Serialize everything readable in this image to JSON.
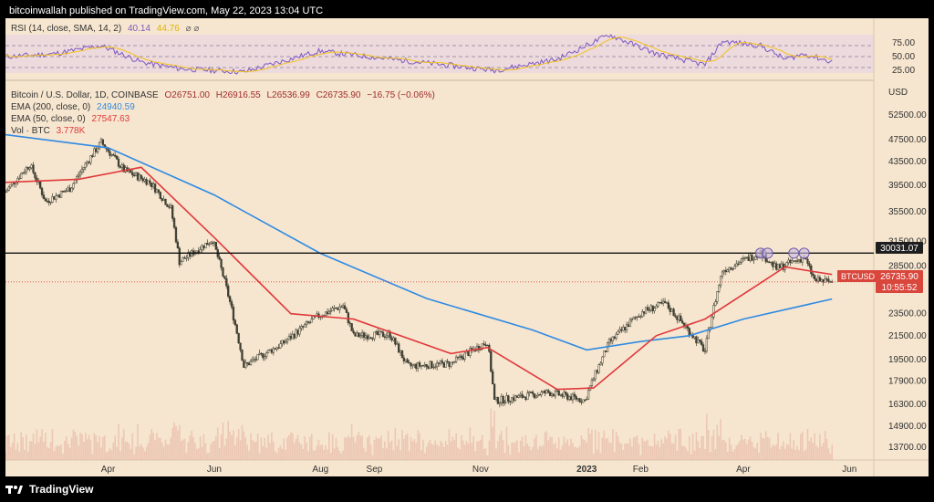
{
  "header": {
    "publish_text": "bitcoinwallah published on TradingView.com, May 22, 2023 13:04 UTC"
  },
  "footer": {
    "brand": "TradingView"
  },
  "rsi_panel": {
    "label": "RSI (14, close, SMA, 14, 2)",
    "rsi_value": "40.14",
    "sma_value": "44.76",
    "ticks": [
      "75.00",
      "50.00",
      "25.00"
    ]
  },
  "main_legend": {
    "symbol": "Bitcoin / U.S. Dollar, 1D, COINBASE",
    "open": "O26751.00",
    "high": "H26916.55",
    "low": "L26536.99",
    "close": "C26735.90",
    "change": "−16.75 (−0.06%)",
    "ema200_label": "EMA (200, close, 0)",
    "ema200_value": "24940.59",
    "ema50_label": "EMA (50, close, 0)",
    "ema50_value": "27547.63",
    "vol_label": "Vol · BTC",
    "vol_value": "3.778K"
  },
  "price_axis": {
    "unit": "USD",
    "ticks": [
      "52500.00",
      "47500.00",
      "43500.00",
      "39500.00",
      "35500.00",
      "31500.00",
      "28500.00",
      "23500.00",
      "21500.00",
      "19500.00",
      "17900.00",
      "16300.00",
      "14900.00",
      "13700.00"
    ],
    "level_label": "30031.07",
    "last_symbol": "BTCUSD",
    "last_price": "26735.90",
    "countdown": "10:55:52"
  },
  "time_axis": {
    "ticks": [
      "Apr",
      "Jun",
      "Aug",
      "Sep",
      "Nov",
      "2023",
      "Feb",
      "Apr",
      "Jun"
    ]
  },
  "colors": {
    "background": "#f6e6cf",
    "ema200": "#2f8ae3",
    "ema50": "#e0393c",
    "rsi": "#7e57c2",
    "rsi_sma": "#f2c21b",
    "candle": "#3f3f33",
    "volume": "#e8b9a8"
  },
  "chart_data": {
    "type": "candlestick",
    "symbol": "Bitcoin / U.S. Dollar",
    "interval": "1D",
    "y_scale": "log",
    "ylim": [
      13000,
      60000
    ],
    "x_range": [
      "2022-02-01",
      "2023-06-15"
    ],
    "horizontal_level": 30031.07,
    "close_path": [
      {
        "x": "2022-02-01",
        "y": 38500
      },
      {
        "x": "2022-02-15",
        "y": 43000
      },
      {
        "x": "2022-02-24",
        "y": 37000
      },
      {
        "x": "2022-03-10",
        "y": 39000
      },
      {
        "x": "2022-03-28",
        "y": 47000
      },
      {
        "x": "2022-04-10",
        "y": 42000
      },
      {
        "x": "2022-04-25",
        "y": 40000
      },
      {
        "x": "2022-05-07",
        "y": 36000
      },
      {
        "x": "2022-05-12",
        "y": 29000
      },
      {
        "x": "2022-05-31",
        "y": 31700
      },
      {
        "x": "2022-06-13",
        "y": 22500
      },
      {
        "x": "2022-06-18",
        "y": 19000
      },
      {
        "x": "2022-07-10",
        "y": 20800
      },
      {
        "x": "2022-07-31",
        "y": 23300
      },
      {
        "x": "2022-08-14",
        "y": 24300
      },
      {
        "x": "2022-08-20",
        "y": 21500
      },
      {
        "x": "2022-09-10",
        "y": 21600
      },
      {
        "x": "2022-09-20",
        "y": 19000
      },
      {
        "x": "2022-10-15",
        "y": 19200
      },
      {
        "x": "2022-11-05",
        "y": 21000
      },
      {
        "x": "2022-11-09",
        "y": 16500
      },
      {
        "x": "2022-12-10",
        "y": 17100
      },
      {
        "x": "2022-12-31",
        "y": 16550
      },
      {
        "x": "2023-01-14",
        "y": 20900
      },
      {
        "x": "2023-02-02",
        "y": 23700
      },
      {
        "x": "2023-02-15",
        "y": 24500
      },
      {
        "x": "2023-03-10",
        "y": 20200
      },
      {
        "x": "2023-03-20",
        "y": 28000
      },
      {
        "x": "2023-04-11",
        "y": 30100
      },
      {
        "x": "2023-04-20",
        "y": 28200
      },
      {
        "x": "2023-05-06",
        "y": 29500
      },
      {
        "x": "2023-05-12",
        "y": 26900
      },
      {
        "x": "2023-05-22",
        "y": 26735.9
      }
    ],
    "ema200": [
      {
        "x": "2022-02-01",
        "y": 48500
      },
      {
        "x": "2022-04-01",
        "y": 46000
      },
      {
        "x": "2022-06-01",
        "y": 38000
      },
      {
        "x": "2022-08-01",
        "y": 30000
      },
      {
        "x": "2022-10-01",
        "y": 25000
      },
      {
        "x": "2022-12-01",
        "y": 22000
      },
      {
        "x": "2023-01-01",
        "y": 20300
      },
      {
        "x": "2023-02-01",
        "y": 21000
      },
      {
        "x": "2023-03-01",
        "y": 21500
      },
      {
        "x": "2023-04-01",
        "y": 23000
      },
      {
        "x": "2023-05-22",
        "y": 24940.59
      }
    ],
    "ema50": [
      {
        "x": "2022-02-01",
        "y": 40000
      },
      {
        "x": "2022-03-15",
        "y": 40500
      },
      {
        "x": "2022-04-20",
        "y": 42500
      },
      {
        "x": "2022-06-01",
        "y": 32000
      },
      {
        "x": "2022-07-15",
        "y": 23500
      },
      {
        "x": "2022-08-20",
        "y": 23000
      },
      {
        "x": "2022-10-15",
        "y": 20000
      },
      {
        "x": "2022-11-05",
        "y": 20500
      },
      {
        "x": "2022-12-15",
        "y": 17300
      },
      {
        "x": "2023-01-05",
        "y": 17400
      },
      {
        "x": "2023-02-10",
        "y": 21500
      },
      {
        "x": "2023-03-10",
        "y": 23000
      },
      {
        "x": "2023-04-10",
        "y": 26500
      },
      {
        "x": "2023-04-25",
        "y": 28400
      },
      {
        "x": "2023-05-22",
        "y": 27547.63
      }
    ],
    "rsi": [
      {
        "x": "2022-02-01",
        "y": 50
      },
      {
        "x": "2022-03-01",
        "y": 55
      },
      {
        "x": "2022-03-28",
        "y": 70
      },
      {
        "x": "2022-04-20",
        "y": 40
      },
      {
        "x": "2022-05-12",
        "y": 28
      },
      {
        "x": "2022-06-18",
        "y": 22
      },
      {
        "x": "2022-07-31",
        "y": 60
      },
      {
        "x": "2022-09-20",
        "y": 42
      },
      {
        "x": "2022-11-09",
        "y": 25
      },
      {
        "x": "2022-12-15",
        "y": 45
      },
      {
        "x": "2023-01-14",
        "y": 90
      },
      {
        "x": "2023-02-10",
        "y": 55
      },
      {
        "x": "2023-03-10",
        "y": 35
      },
      {
        "x": "2023-03-20",
        "y": 78
      },
      {
        "x": "2023-04-11",
        "y": 70
      },
      {
        "x": "2023-04-25",
        "y": 45
      },
      {
        "x": "2023-05-06",
        "y": 55
      },
      {
        "x": "2023-05-22",
        "y": 40.14
      }
    ],
    "rsi_levels": [
      70,
      50,
      30
    ],
    "marked_highs": [
      "2023-04-11",
      "2023-04-15",
      "2023-04-30",
      "2023-05-06"
    ]
  }
}
